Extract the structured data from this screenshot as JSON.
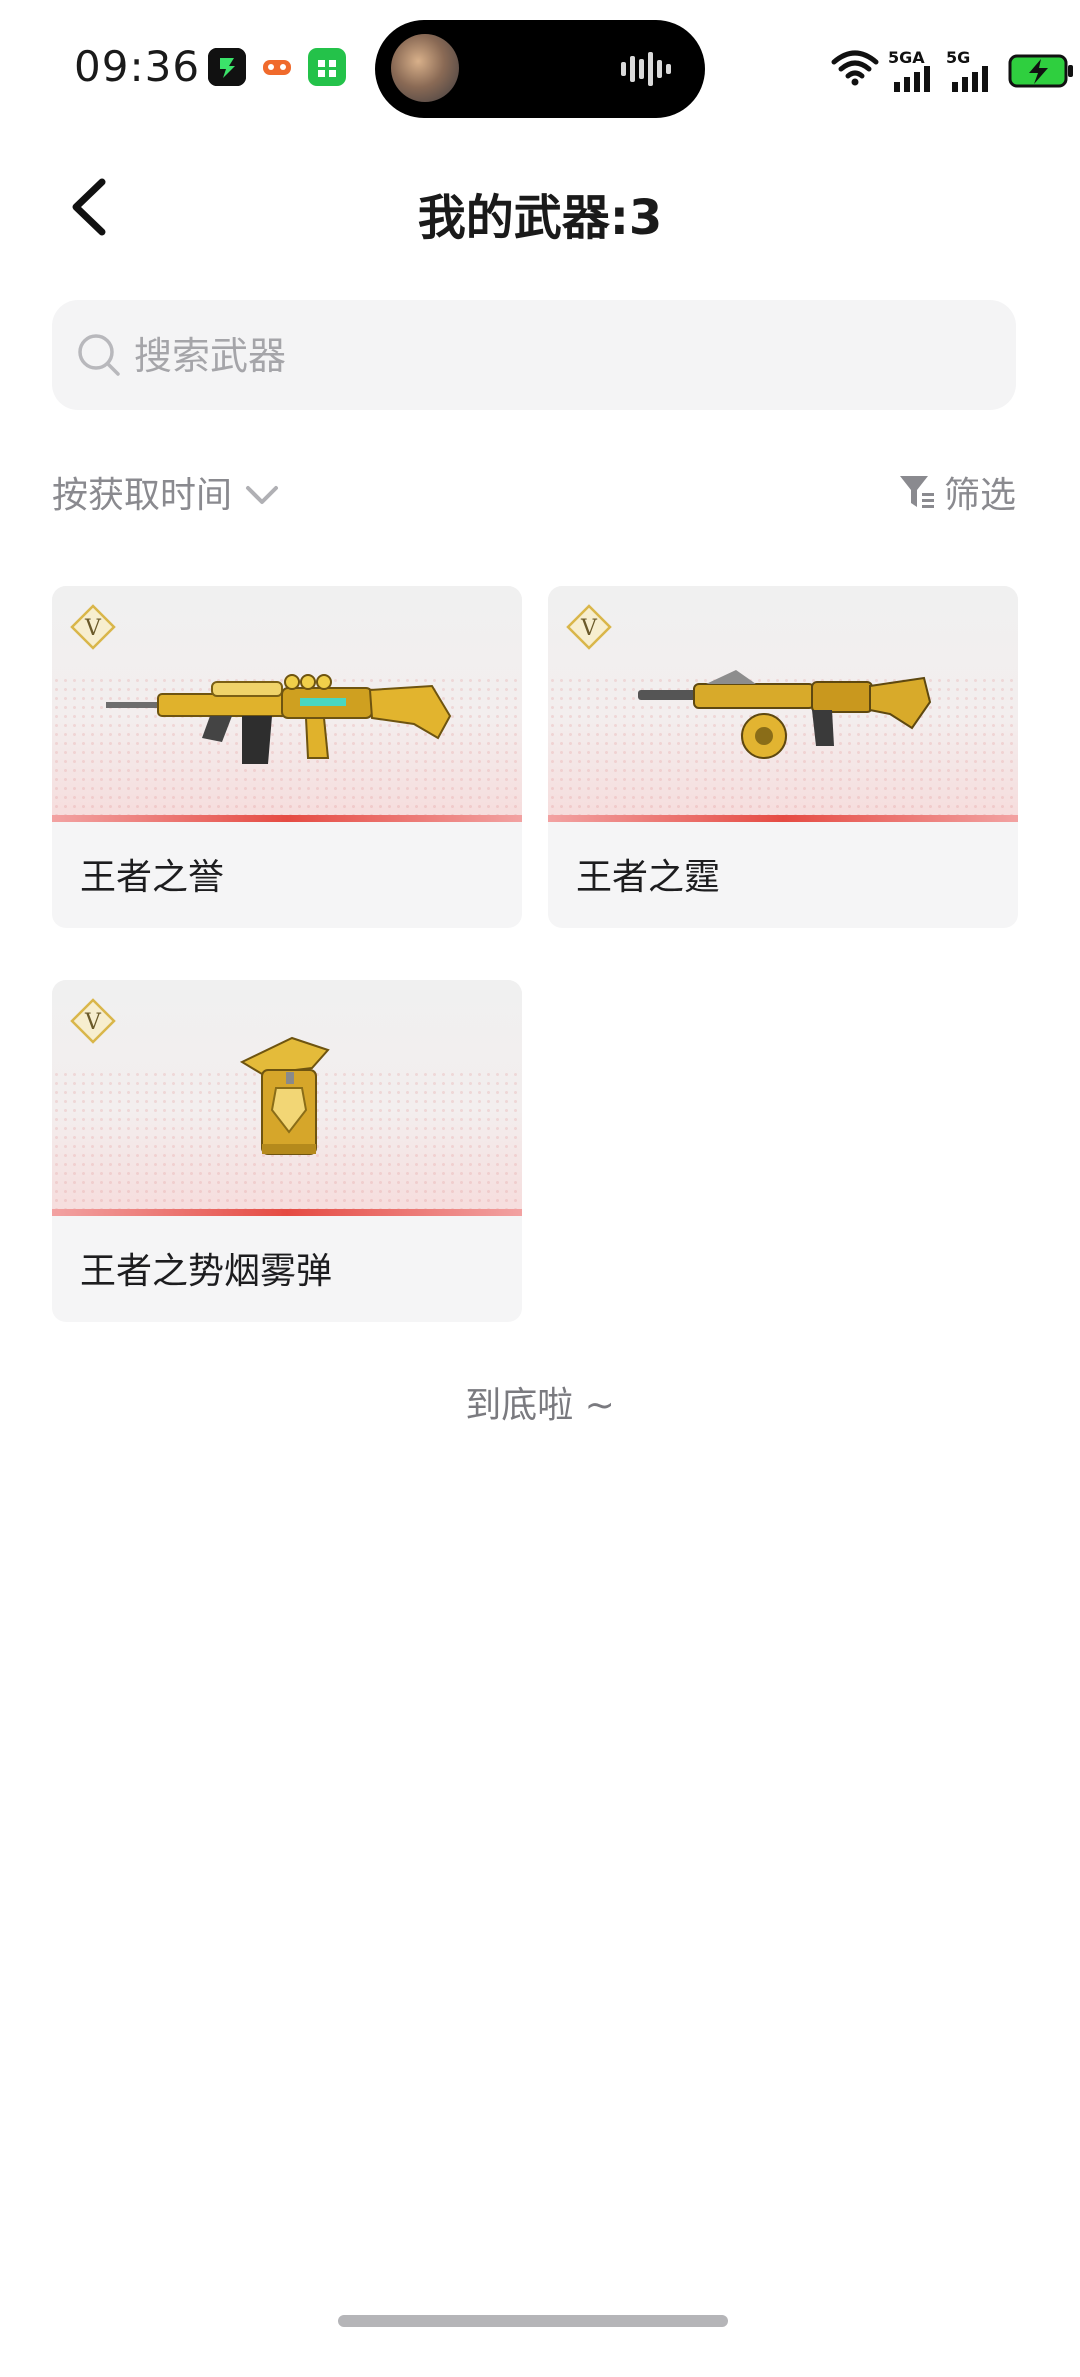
{
  "status_bar": {
    "time": "09:36",
    "signal_1_label": "5GA",
    "signal_2_label": "5G",
    "icons": [
      "app-green-icon",
      "game-icon",
      "store-icon",
      "wifi-icon",
      "signal-icon",
      "battery-charging-icon"
    ]
  },
  "header": {
    "title": "我的武器:3",
    "back_icon": "chevron-left-icon"
  },
  "search": {
    "placeholder": "搜索武器",
    "value": ""
  },
  "toolbar": {
    "sort_label": "按获取时间",
    "filter_label": "筛选"
  },
  "weapons": [
    {
      "name": "王者之誉",
      "badge": "V"
    },
    {
      "name": "王者之霆",
      "badge": "V"
    },
    {
      "name": "王者之势烟雾弹",
      "badge": "V"
    }
  ],
  "footer": {
    "end_text": "到底啦 ~"
  },
  "colors": {
    "accent_stripe": "#e54b43",
    "gold": "#d9a828",
    "card_bg": "#f5f5f6",
    "secondary_text": "#8a8a8f"
  }
}
